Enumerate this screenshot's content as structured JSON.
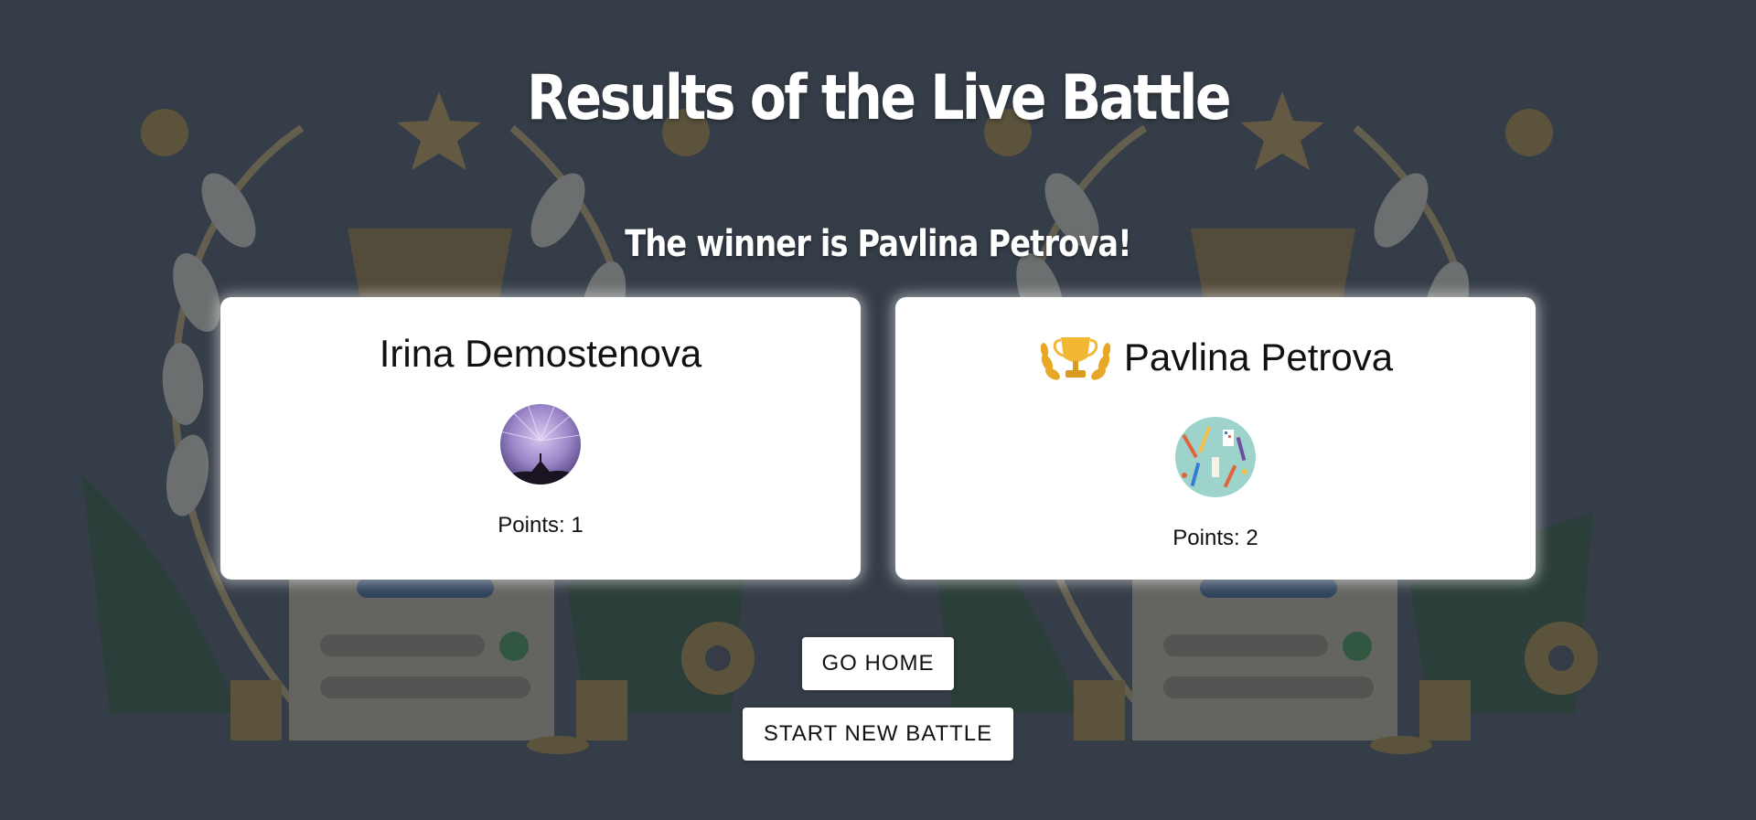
{
  "page": {
    "title": "Results of the Live Battle",
    "winner_text": "The winner is Pavlina Petrova!"
  },
  "players": [
    {
      "name": "Irina Demostenova",
      "points_text": "Points: 1",
      "points": 1,
      "is_winner": false,
      "avatar": "starry-night-avatar"
    },
    {
      "name": "Pavlina Petrova",
      "points_text": "Points: 2",
      "points": 2,
      "is_winner": true,
      "avatar": "art-supplies-avatar",
      "badge_icon": "trophy-icon"
    }
  ],
  "buttons": {
    "go_home": "GO HOME",
    "start_new_battle": "START NEW BATTLE"
  },
  "colors": {
    "background": "#353d48",
    "card": "#ffffff",
    "title_text": "#ffffff",
    "trophy_gold": "#e8a825"
  }
}
